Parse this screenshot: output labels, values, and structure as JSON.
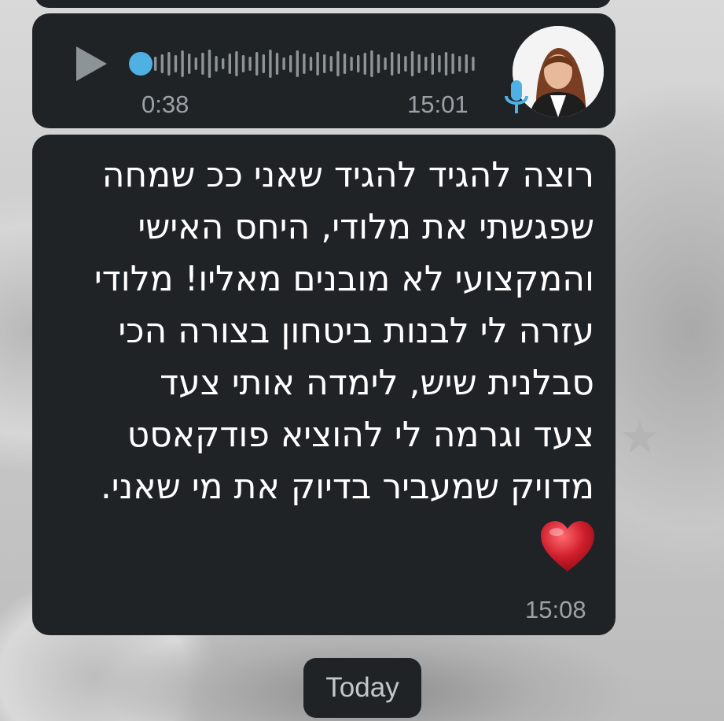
{
  "voice_message": {
    "duration": "0:38",
    "time": "15:01"
  },
  "text_message": {
    "body": "רוצה להגיד להגיד שאני ככ שמחה\nשפגשתי את מלודי, היחס האישי\nוהמקצועי לא מובנים מאליו! מלודי\nעזרה לי לבנות ביטחון בצורה הכי\nסבלנית שיש, לימדה אותי צעד\nצעד וגרמה לי להוציא פודקאסט\nמדויק שמעביר בדיוק את מי שאני.",
    "emoji": "heart-icon",
    "time": "15:08"
  },
  "date_divider": "Today",
  "colors": {
    "bubble": "#202326",
    "accent": "#4fb1e3",
    "meta_text": "#9aa2a8",
    "heart": "#d01e2b"
  }
}
